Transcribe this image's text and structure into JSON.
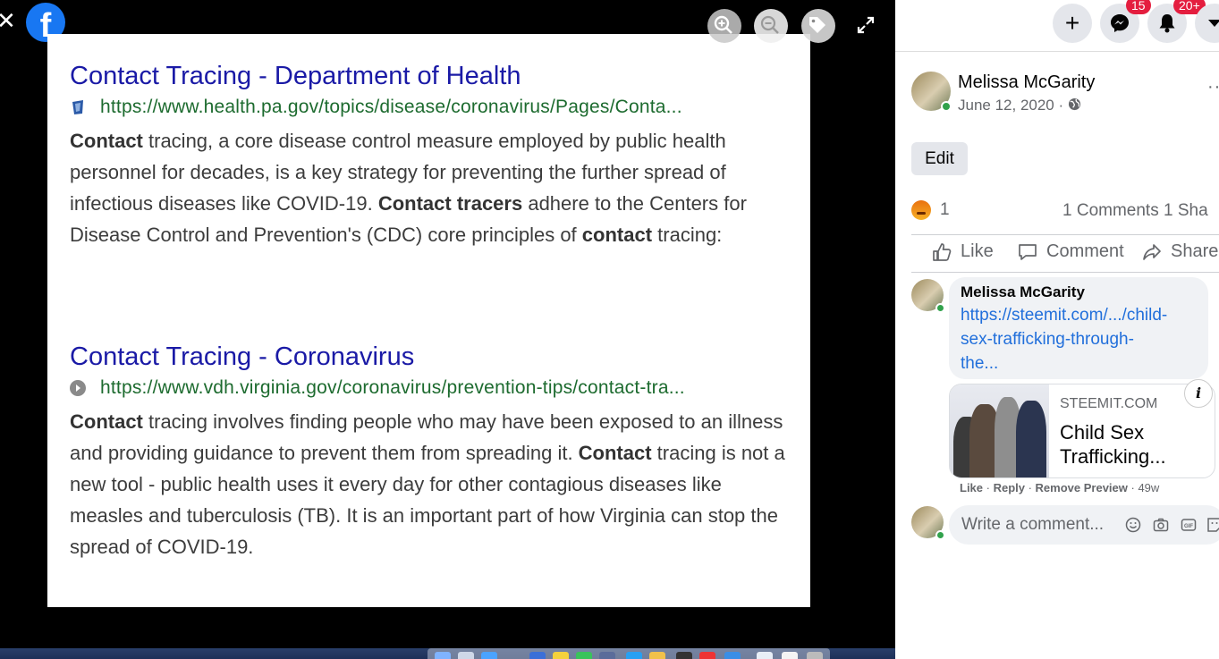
{
  "viewer": {
    "close_icon": "close-icon",
    "logo_letter": "f",
    "controls": [
      "zoom-in-icon",
      "zoom-out-icon",
      "tag-icon",
      "fullscreen-icon"
    ]
  },
  "photo": {
    "results": [
      {
        "title": "Contact Tracing - Department of Health",
        "url": "https://www.health.pa.gov/topics/disease/coronavirus/Pages/Conta...",
        "snippet": [
          {
            "t": "Contact",
            "b": true
          },
          {
            "t": " tracing, a core disease control measure employed by public health personnel for decades, is a key strategy for preventing the further spread of infectious diseases like COVID-19. ",
            "b": false
          },
          {
            "t": "Contact tracers",
            "b": true
          },
          {
            "t": " adhere to the Centers for Disease Control and Prevention's (CDC) core principles of ",
            "b": false
          },
          {
            "t": "contact",
            "b": true
          },
          {
            "t": " tracing:",
            "b": false
          }
        ]
      },
      {
        "title": "Contact Tracing - Coronavirus",
        "url": "https://www.vdh.virginia.gov/coronavirus/prevention-tips/contact-tra...",
        "snippet": [
          {
            "t": "Contact",
            "b": true
          },
          {
            "t": " tracing involves finding people who may have been exposed to an illness and providing guidance to prevent them from spreading it. ",
            "b": false
          },
          {
            "t": "Contact",
            "b": true
          },
          {
            "t": " tracing is not a new tool - public health uses it every day for other contagious diseases like measles and tuberculosis (TB). It is an important part of how Virginia can stop the spread of COVID-19.",
            "b": false
          }
        ]
      }
    ]
  },
  "topbar": {
    "create_icon": "plus-icon",
    "messenger_badge": "15",
    "notifications_badge": "20+"
  },
  "post": {
    "author": "Melissa McGarity",
    "date": "June 12, 2020 · ",
    "privacy_icon": "globe-icon",
    "more_label": "··",
    "edit_label": "Edit",
    "reaction_icon": "angry-reaction-icon",
    "reaction_count": "1",
    "comment_share_counts": "1 Comments  1 Sha",
    "actions": {
      "like": "Like",
      "comment": "Comment",
      "share": "Share"
    }
  },
  "comment": {
    "author": "Melissa McGarity",
    "link_text": "https://steemit.com/.../child-sex-trafficking-through-the...",
    "link_lines": [
      "https://steemit.com/.../child-",
      "sex-trafficking-through-",
      "the..."
    ],
    "preview": {
      "site": "STEEMIT.COM",
      "title": "Child Sex Trafficking..."
    },
    "info_label": "i",
    "meta": {
      "like": "Like",
      "reply": "Reply",
      "remove_preview": "Remove Preview",
      "age": "49w"
    }
  },
  "composer": {
    "placeholder": "Write a comment..."
  }
}
